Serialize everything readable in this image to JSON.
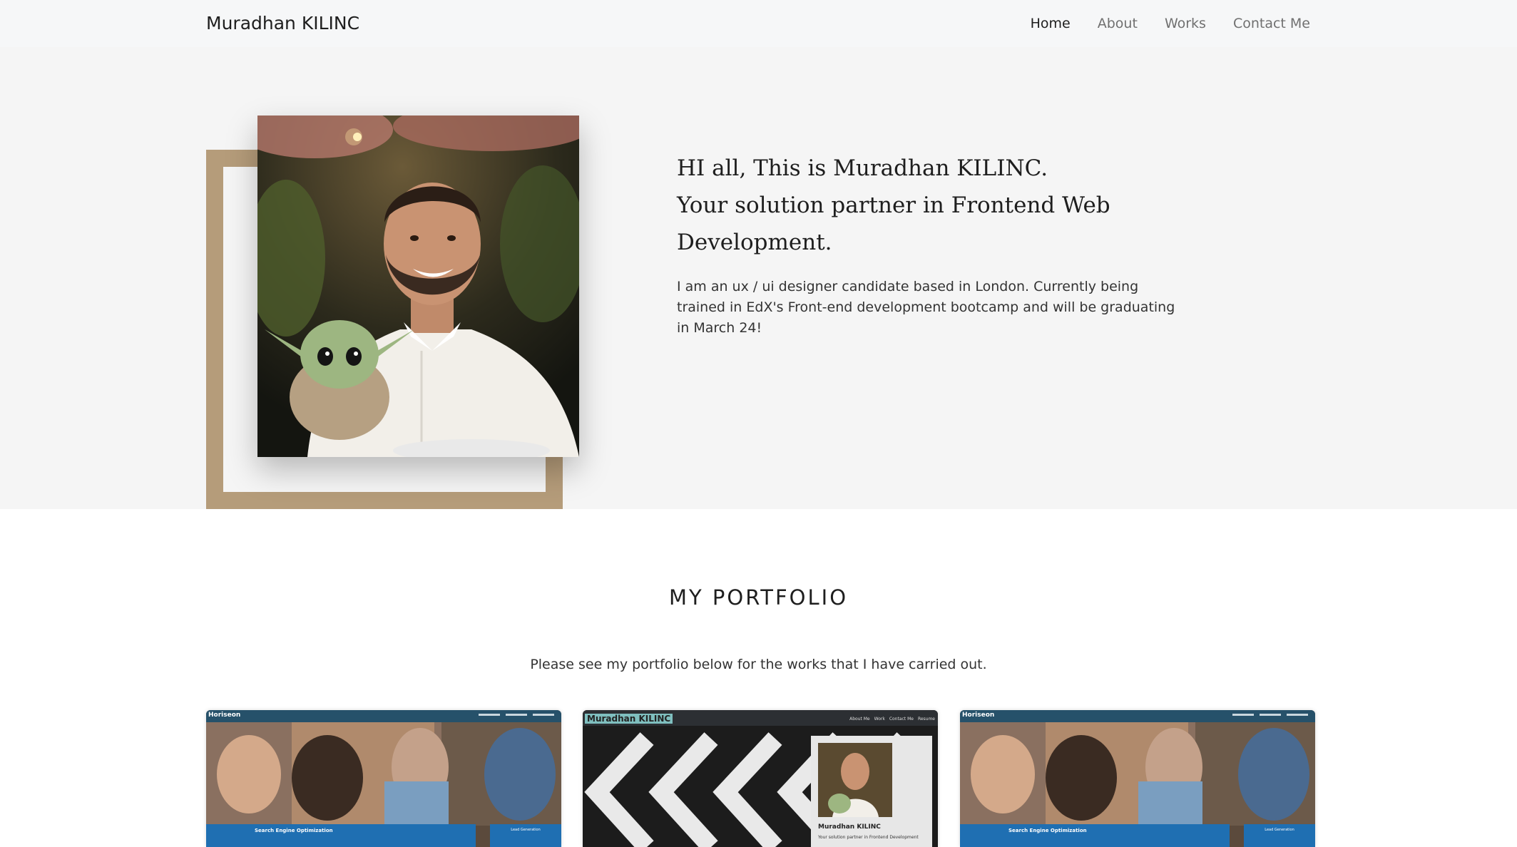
{
  "nav": {
    "brand": "Muradhan KILINC",
    "links": [
      {
        "label": "Home",
        "active": true
      },
      {
        "label": "About"
      },
      {
        "label": "Works"
      },
      {
        "label": "Contact Me"
      }
    ]
  },
  "hero": {
    "title_line1": "HI all, This is Muradhan KILINC.",
    "title_line2": "Your solution partner in Frontend Web Development.",
    "description": "I am an ux / ui designer candidate based in London. Currently being trained in EdX's Front-end development bootcamp and will be graduating in March 24!"
  },
  "portfolio": {
    "heading": "MY PORTFOLIO",
    "subtitle": "Please see my portfolio below for the works that I have carried out.",
    "cards": [
      {
        "site_logo": "Horiseon",
        "section_title": "Search Engine Optimization",
        "side_title": "Lead Generation"
      },
      {
        "site_logo": "Muradhan KILINC",
        "nav": [
          "About Me",
          "Work",
          "Contact Me",
          "Resume"
        ],
        "profile_name": "Muradhan KILINC",
        "profile_sub": "Your solution partner in Frontend Development"
      },
      {
        "site_logo": "Horiseon",
        "section_title": "Search Engine Optimization",
        "side_title": "Lead Generation"
      }
    ]
  },
  "colors": {
    "frame_accent": "#b59c7a",
    "hero_bg": "#f5f5f5",
    "navbar_bg": "#f6f7f8",
    "mockup_blue": "#1f6fb2"
  }
}
